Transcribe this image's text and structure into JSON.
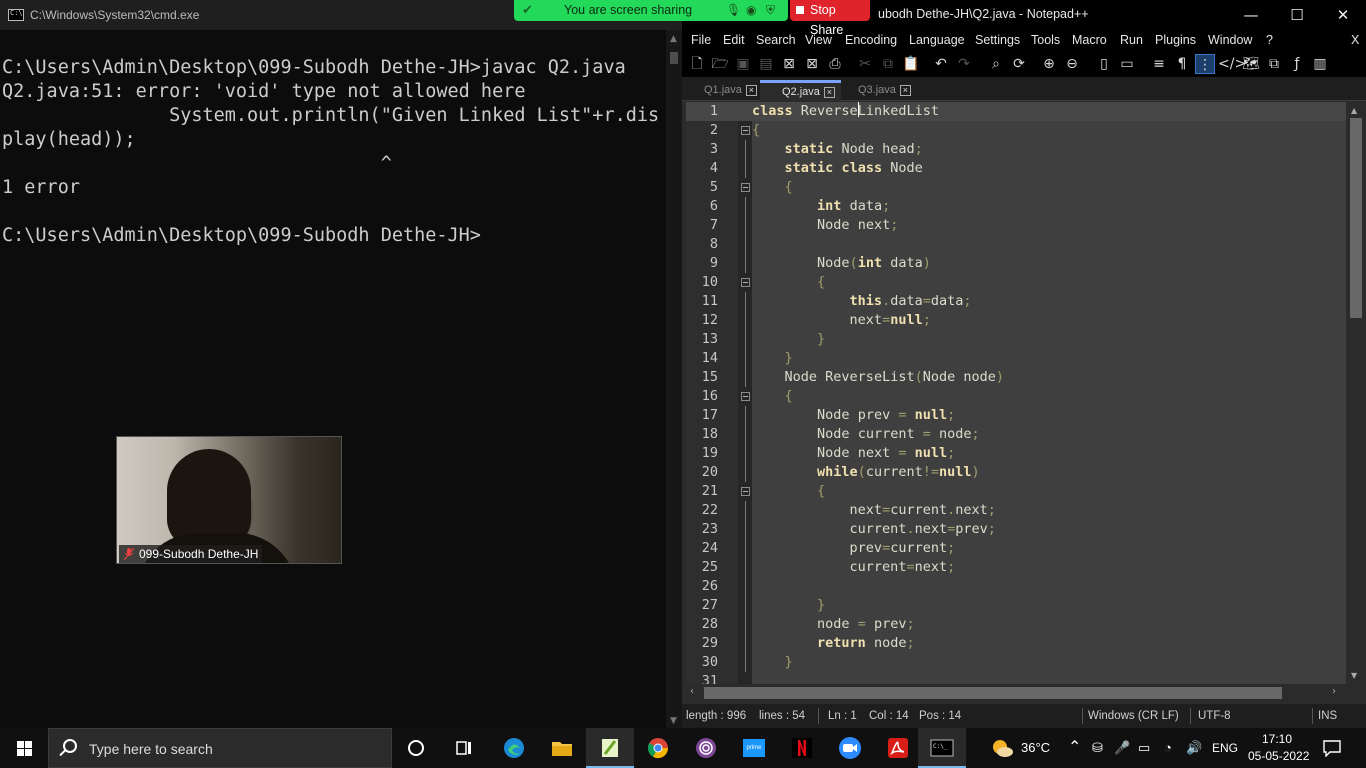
{
  "cmd": {
    "title": "C:\\Windows\\System32\\cmd.exe",
    "lines": [
      "C:\\Users\\Admin\\Desktop\\099-Subodh Dethe-JH>javac Q2.java",
      "Q2.java:51: error: 'void' type not allowed here",
      "               System.out.println(\"Given Linked List\"+r.dis",
      "play(head));",
      "                                  ^",
      "1 error",
      "",
      "C:\\Users\\Admin\\Desktop\\099-Subodh Dethe-JH>"
    ]
  },
  "video": {
    "participant": "099-Subodh Dethe-JH",
    "muted_icon": "mic-muted-icon"
  },
  "share_banner": {
    "status": "You are screen sharing",
    "stop_label": "Stop Share",
    "colors": {
      "green": "#23d959",
      "red": "#e0242c"
    }
  },
  "npp": {
    "title": "ubodh Dethe-JH\\Q2.java - Notepad++",
    "window_controls": {
      "minimize": "—",
      "maximize": "☐",
      "close": "✕"
    },
    "menu": [
      "File",
      "Edit",
      "Search",
      "View",
      "Encoding",
      "Language",
      "Settings",
      "Tools",
      "Macro",
      "Run",
      "Plugins",
      "Window",
      "?"
    ],
    "menu_close": "X",
    "tabs": [
      {
        "label": "Q1.java",
        "active": false
      },
      {
        "label": "Q2.java",
        "active": true
      },
      {
        "label": "Q3.java",
        "active": false
      }
    ],
    "code": [
      "class ReverseLinkedList",
      "{",
      "    static Node head;",
      "    static class Node",
      "    {",
      "        int data;",
      "        Node next;",
      "",
      "        Node(int data)",
      "        {",
      "            this.data=data;",
      "            next=null;",
      "        }",
      "    }",
      "    Node ReverseList(Node node)",
      "    {",
      "        Node prev = null;",
      "        Node current = node;",
      "        Node next = null;",
      "        while(current!=null)",
      "        {",
      "            next=current.next;",
      "            current.next=prev;",
      "            prev=current;",
      "            current=next;",
      "",
      "        }",
      "        node = prev;",
      "        return node;",
      "    }",
      ""
    ],
    "status": {
      "length": "length : 996",
      "lines": "lines : 54",
      "ln": "Ln : 1",
      "col": "Col : 14",
      "pos": "Pos : 14",
      "eol": "Windows (CR LF)",
      "encoding": "UTF-8",
      "mode": "INS"
    }
  },
  "taskbar": {
    "search_placeholder": "Type here to search",
    "weather": "36°C",
    "language": "ENG",
    "time": "17:10",
    "date": "05-05-2022",
    "apps": [
      "task-view-icon",
      "edge-icon",
      "file-explorer-icon",
      "notepadpp-icon",
      "chrome-icon",
      "tor-icon",
      "prime-video-icon",
      "netflix-icon",
      "zoom-icon",
      "acrobat-icon",
      "cmd-icon"
    ]
  }
}
